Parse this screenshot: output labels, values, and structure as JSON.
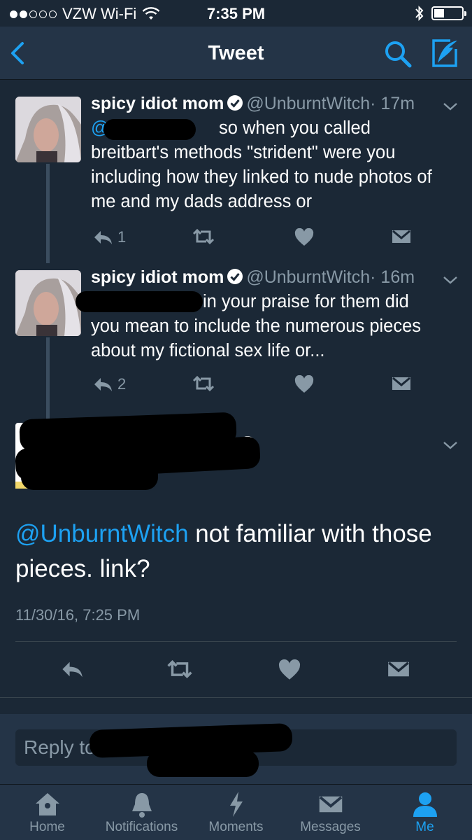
{
  "status_bar": {
    "carrier": "VZW Wi-Fi",
    "time": "7:35 PM",
    "signal_dots_filled": 2,
    "signal_dots_total": 5
  },
  "nav": {
    "title": "Tweet"
  },
  "tweets": [
    {
      "name": "spicy idiot mom",
      "handle": "@UnburntWitch",
      "time": "· 17m",
      "mention_fragment": "@",
      "text_line1": "so when you called",
      "text_rest": "breitbart's methods \"strident\" were you including how they linked to nude photos of me and my dads address or",
      "reply_count": "1"
    },
    {
      "name": "spicy idiot mom",
      "handle": "@UnburntWitch",
      "time": "· 16m",
      "text_line1": "in your praise for them did",
      "text_rest": "you mean to include the numerous pieces about my fictional sex life or...",
      "reply_count": "2"
    }
  ],
  "main_tweet": {
    "mention": "@UnburntWitch",
    "text": " not familiar with those pieces. link?",
    "date": "11/30/16, 7:25 PM"
  },
  "reply": {
    "placeholder_visible": "Reply to"
  },
  "tabs": [
    {
      "label": "Home",
      "icon": "home-icon"
    },
    {
      "label": "Notifications",
      "icon": "bell-icon"
    },
    {
      "label": "Moments",
      "icon": "lightning-icon"
    },
    {
      "label": "Messages",
      "icon": "envelope-icon"
    },
    {
      "label": "Me",
      "icon": "person-icon"
    }
  ],
  "colors": {
    "background": "#1b2836",
    "bar": "#243447",
    "accent": "#1da1f2",
    "muted": "#8899a6"
  }
}
